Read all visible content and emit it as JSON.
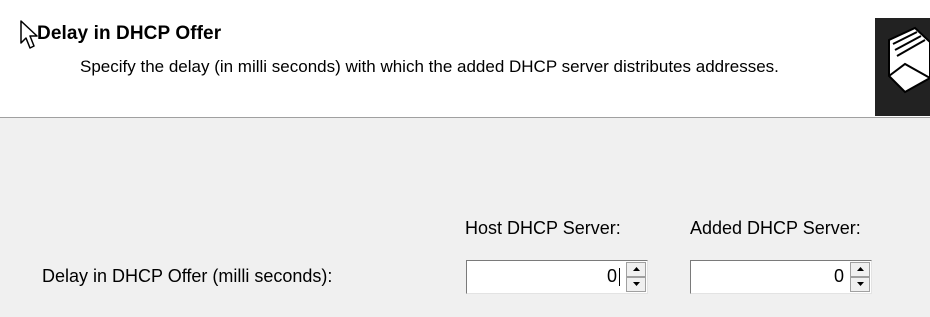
{
  "header": {
    "title": "Delay in DHCP Offer",
    "description": "Specify the delay (in milli seconds) with which the added DHCP server distributes addresses."
  },
  "form": {
    "host_column_label": "Host DHCP Server:",
    "added_column_label": "Added DHCP Server:",
    "row_label": "Delay in DHCP Offer (milli seconds):",
    "host_value": "0",
    "added_value": "0"
  },
  "icons": {
    "cursor": "mouse-pointer-icon",
    "logo": "wizard-folder-icon",
    "spin_up": "arrow-up-icon",
    "spin_down": "arrow-down-icon"
  }
}
